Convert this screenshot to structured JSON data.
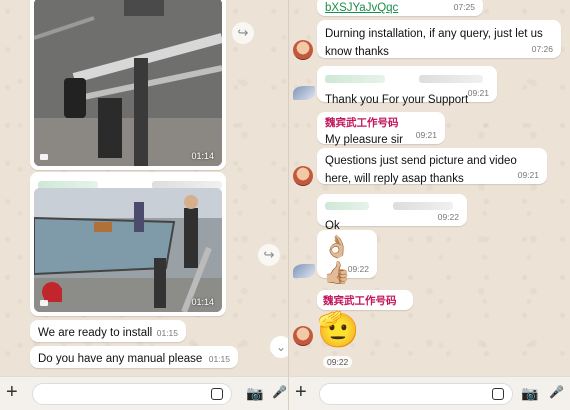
{
  "left_chat": {
    "photo1": {
      "time": "01:14"
    },
    "photo2": {
      "time": "01:14"
    },
    "messages": [
      {
        "text": "We are ready to install",
        "time": "01:15"
      },
      {
        "text": "Do you have any manual please",
        "time": "01:15"
      }
    ],
    "composer": {
      "placeholder": ""
    }
  },
  "right_chat": {
    "top_link": {
      "text": "bXSJYaJvQqc",
      "time": "07:25"
    },
    "messages": [
      {
        "text": "Durning installation, if any query, just let us know thanks",
        "time": "07:26"
      },
      {
        "text": "Thank you For your Support",
        "time": "09:21"
      },
      {
        "sender": "魏宾武工作号码",
        "text": "My pleasure sir",
        "time": "09:21"
      },
      {
        "text": "Questions just send picture and video here, will reply asap thanks",
        "time": "09:21"
      },
      {
        "text": "Ok",
        "time": "09:22"
      },
      {
        "emoji": "👌🏼👍🏼",
        "time": "09:22"
      },
      {
        "sender": "魏宾武工作号码",
        "emoji": "🫡",
        "time": "09:22"
      }
    ],
    "composer": {
      "placeholder": ""
    }
  },
  "icons": {
    "forward": "↪",
    "plus": "+",
    "camera": "📷",
    "mic": "🎤",
    "chevron_down": "⌄"
  }
}
